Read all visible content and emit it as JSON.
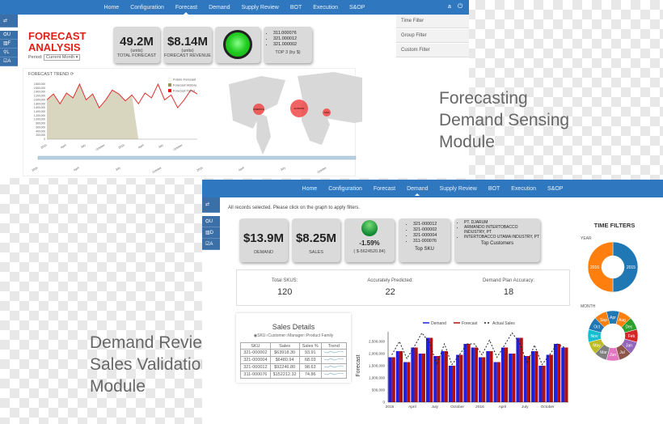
{
  "colors": {
    "nav": "#2f78bf",
    "title_red": "#e0201b",
    "demand": "#1f1fe0",
    "forecast": "#b01010",
    "history": "#d9d6c0",
    "trend": "#e03030"
  },
  "top": {
    "nav": [
      "Home",
      "Configuration",
      "Forecast",
      "Demand",
      "Supply Review",
      "BOT",
      "Execution",
      "S&OP"
    ],
    "active": "Forecast",
    "user": "a",
    "power_icon": "power-icon",
    "title1": "FORECAST",
    "title2": "ANALYSIS",
    "period_label": "Period:",
    "period_value": "Current Month",
    "kpis": [
      {
        "value": "49.2M",
        "unit": "(units)",
        "label": "TOTAL FORECAST"
      },
      {
        "value": "$8.14M",
        "unit": "(units)",
        "label": "FORECAST REVENUE"
      }
    ],
    "status_light": "green",
    "top3": {
      "items": [
        "311.000076",
        "321.000012",
        "321.000002"
      ],
      "label": "TOP 3 (by $)"
    },
    "filters": [
      "Time Filter",
      "Group Filter",
      "Custom Filter"
    ],
    "chart_title": "FORECAST TREND",
    "legend": [
      "Future Forecast",
      "Forecast History",
      "Forecast Trend"
    ],
    "map_labels": [
      "AMERICA",
      "EUROPE",
      "ASIA"
    ],
    "x_ticks": [
      "2015",
      "April",
      "July",
      "October",
      "2016",
      "April",
      "July",
      "October"
    ],
    "nav_ticks": [
      "2015",
      "April",
      "July",
      "October",
      "2016",
      "April",
      "July",
      "October"
    ]
  },
  "chart_data": [
    {
      "type": "line",
      "title": "FORECAST TREND",
      "ylim": [
        0,
        2800000
      ],
      "yticks": [
        "2,800,000",
        "2,600,000",
        "2,400,000",
        "2,200,000",
        "2,000,000",
        "1,800,000",
        "1,600,000",
        "1,400,000",
        "1,200,000",
        "1,000,000",
        "800,000",
        "600,000",
        "400,000",
        "200,000",
        "0"
      ],
      "series": [
        {
          "name": "Forecast Trend",
          "values": [
            2000000,
            2300000,
            1800000,
            2350000,
            2100000,
            2800000,
            2000000,
            2300000,
            1600000,
            2000000,
            2500000,
            2300000,
            1950000,
            2250000,
            1800000,
            2350000,
            2100000,
            2800000,
            2000000,
            2250000,
            1600000,
            2000000,
            2500000,
            2300000
          ]
        },
        {
          "name": "Forecast History",
          "values": [
            2000000,
            2300000,
            1800000,
            2350000,
            2100000,
            2800000,
            2000000,
            2300000,
            1600000,
            2000000,
            2500000,
            2300000,
            1950000,
            2250000,
            0
          ]
        }
      ]
    },
    {
      "type": "bar",
      "ylabel": "Forecast",
      "ylim": [
        0,
        2900000
      ],
      "yticks": [
        "2,500,000",
        "2,000,000",
        "1,500,000",
        "1,000,000",
        "500,000",
        "0"
      ],
      "x_ticks": [
        "2015",
        "April",
        "July",
        "October",
        "2016",
        "April",
        "July",
        "October"
      ],
      "series": [
        {
          "name": "Demand",
          "values": [
            1850000,
            2100000,
            1650000,
            2250000,
            2000000,
            2650000,
            1900000,
            2100000,
            1500000,
            1950000,
            2400000,
            2250000,
            1850000,
            2100000,
            1650000,
            2250000,
            2000000,
            2650000,
            1900000,
            2100000,
            1500000,
            1950000,
            2400000,
            2250000
          ]
        },
        {
          "name": "Forecast",
          "values": [
            1850000,
            2100000,
            1650000,
            2250000,
            2000000,
            2650000,
            1900000,
            2100000,
            1500000,
            1950000,
            2400000,
            2250000,
            1850000,
            2100000,
            1650000,
            2250000,
            2000000,
            2650000,
            1900000,
            2100000,
            1500000,
            1950000,
            2400000,
            2250000
          ]
        },
        {
          "name": "Actual Sales",
          "values": [
            1950000,
            2500000,
            1800000,
            2300000,
            2850000,
            2450000,
            1550000,
            2400000,
            1550000,
            1950000,
            2400000,
            2400000,
            1950000,
            2550000,
            1850000,
            2350000,
            2850000,
            2450000,
            1600000,
            2350000,
            1550000,
            1950000,
            2400000,
            2250000
          ]
        }
      ]
    },
    {
      "type": "pie",
      "title": "YEAR",
      "categories": [
        "2015",
        "2016"
      ],
      "values": [
        50,
        50
      ],
      "colors": [
        "#1f77b4",
        "#ff7f0e"
      ]
    },
    {
      "type": "pie",
      "title": "MONTH",
      "categories": [
        "Apr",
        "Aug",
        "Dec",
        "Feb",
        "Jan",
        "Jul",
        "Jun",
        "Mar",
        "May",
        "Nov",
        "Oct",
        "Sep"
      ],
      "values": [
        1,
        1,
        1,
        1,
        1,
        1,
        1,
        1,
        1,
        1,
        1,
        1
      ],
      "colors": [
        "#1f77b4",
        "#ff7f0e",
        "#2ca02c",
        "#d62728",
        "#9467bd",
        "#8c564b",
        "#e377c2",
        "#7f7f7f",
        "#bcbd22",
        "#17becf",
        "#1f77b4",
        "#ff7f0e"
      ]
    }
  ],
  "bottom": {
    "nav": [
      "Home",
      "Configuration",
      "Forecast",
      "Demand",
      "Supply Review",
      "BOT",
      "Execution",
      "S&OP"
    ],
    "active": "Demand",
    "message": "All records selected. Please click on the graph to apply filters.",
    "kpis": [
      {
        "value": "$13.9M",
        "label": "DEMAND"
      },
      {
        "value": "$8.25M",
        "label": "SALES"
      }
    ],
    "variance": {
      "pct": "-1.59%",
      "amount": "( $-5624520.84)"
    },
    "top_sku": {
      "items": [
        "321-000012",
        "321-000002",
        "321-000004",
        "311-000076"
      ],
      "label": "Top SKU"
    },
    "top_customers": {
      "items": [
        "PT. DJARUM",
        "ARMANDO INTERTOBACCO INDUSTRY, PT",
        "INTERTOBACCO UTAMA INDUSTRY, PT"
      ],
      "label": "Top Customers"
    },
    "stats": [
      {
        "label": "Total SKUS:",
        "value": "120"
      },
      {
        "label": "Accurately Predicted:",
        "value": "22"
      },
      {
        "label": "Demand Plan Accuracy:",
        "value": "18"
      }
    ],
    "time_filters": "TIME FILTERS",
    "year": "YEAR",
    "month": "MONTH",
    "sales_details": {
      "title": "Sales Details",
      "radios": [
        "SKU",
        "Customer",
        "Manager",
        "Product Family"
      ],
      "selected": "SKU",
      "headers": [
        "SKU",
        "Sales",
        "Sales %",
        "Trend"
      ],
      "rows": [
        [
          "321-000002",
          "$63918.30",
          "93.91"
        ],
        [
          "321-000004",
          "$6480.94",
          "68.03"
        ],
        [
          "321-000012",
          "$92246.80",
          "98.63"
        ],
        [
          "311-000076",
          "$152212.32",
          "74.86"
        ]
      ]
    },
    "legend": [
      "Demand",
      "Forecast",
      "Actual Sales"
    ]
  },
  "captions": {
    "top": [
      "Forecasting",
      "Demand Sensing",
      "Module"
    ],
    "bottom": [
      "Demand Review",
      "Sales Validation",
      "Module"
    ]
  }
}
